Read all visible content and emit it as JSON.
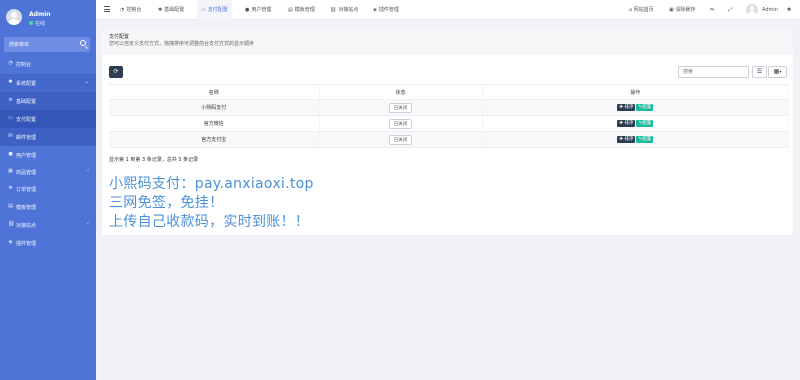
{
  "sidebar": {
    "profile": {
      "name": "Admin",
      "status": "在线"
    },
    "search_placeholder": "搜索菜单",
    "items": [
      {
        "label": "控制台",
        "icon": "dashboard-icon"
      },
      {
        "label": "系统配置",
        "icon": "gear-icon",
        "expanded": true
      },
      {
        "label": "基础配置",
        "icon": "sliders-icon"
      },
      {
        "label": "支付配置",
        "icon": "credit-card-icon"
      },
      {
        "label": "邮件管理",
        "icon": "envelope-icon"
      },
      {
        "label": "用户管理",
        "icon": "user-icon"
      },
      {
        "label": "商品管理",
        "icon": "shop-icon"
      },
      {
        "label": "订单管理",
        "icon": "list-icon"
      },
      {
        "label": "模板管理",
        "icon": "template-icon"
      },
      {
        "label": "对接站点",
        "icon": "link-icon"
      },
      {
        "label": "插件管理",
        "icon": "plugin-icon"
      }
    ]
  },
  "topbar": {
    "tabs": [
      {
        "label": "控制台",
        "icon": "dashboard-icon"
      },
      {
        "label": "基础配置",
        "icon": "gear-icon"
      },
      {
        "label": "支付配置",
        "icon": "credit-card-icon",
        "active": true
      },
      {
        "label": "用户管理",
        "icon": "user-icon"
      },
      {
        "label": "模板管理",
        "icon": "template-icon"
      },
      {
        "label": "对接站点",
        "icon": "link-icon"
      },
      {
        "label": "插件管理",
        "icon": "plugin-icon"
      }
    ],
    "right": {
      "home_label": "网站首页",
      "cache_label": "清除缓存",
      "user_name": "Admin"
    }
  },
  "panel": {
    "title": "支付配置",
    "description": "您可以自定义支付方式，拖拽排序可调整前台支付方式的显示顺序",
    "search_placeholder": "搜索",
    "columns": [
      "名称",
      "状态",
      "操作"
    ],
    "rows": [
      {
        "name": "小熙码支付",
        "status": "已关闭"
      },
      {
        "name": "官方微信",
        "status": "已关闭"
      },
      {
        "name": "官方支付宝",
        "status": "已关闭"
      }
    ],
    "sort_label": "排序",
    "edit_label": "配置",
    "summary": "显示第 1 到第 3 条记录，总共 3 条记录"
  },
  "promo": {
    "line1": "小熙码支付：pay.anxiaoxi.top",
    "line2": "三网免签，免挂！",
    "line3": "上传自己收款码，实时到账！！"
  },
  "colors": {
    "sidebar": "#4f74d8",
    "accent": "#4f74d8",
    "dark_button": "#2c3e50",
    "green_button": "#18bc9c",
    "promo_text": "#4a90d9"
  }
}
